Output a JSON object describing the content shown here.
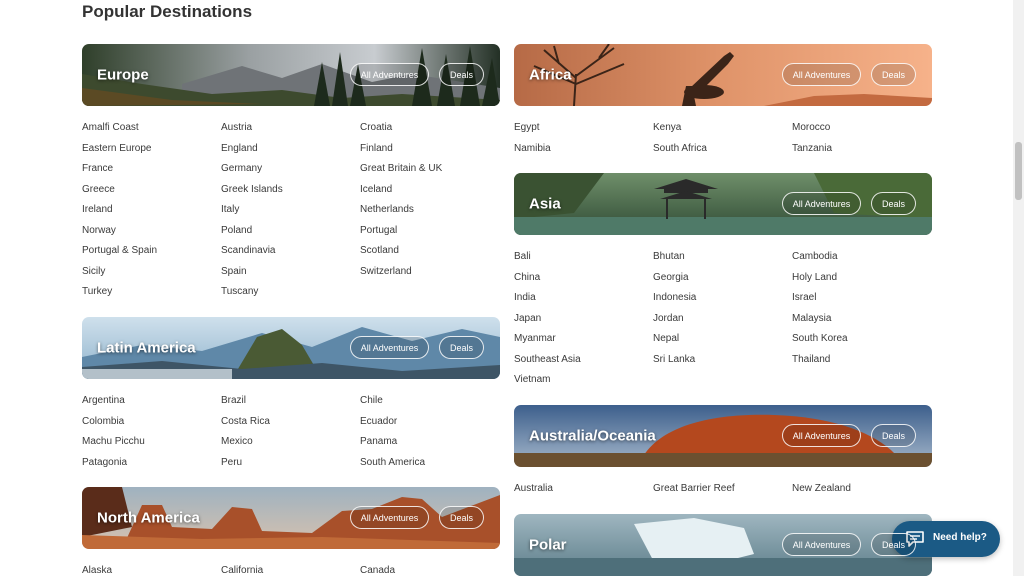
{
  "page_title": "Popular Destinations",
  "sections": {
    "europe": {
      "title": "Europe",
      "all_label": "All Adventures",
      "deals_label": "Deals",
      "links": [
        "Amalfi Coast",
        "Austria",
        "Croatia",
        "Eastern Europe",
        "England",
        "Finland",
        "France",
        "Germany",
        "Great Britain & UK",
        "Greece",
        "Greek Islands",
        "Iceland",
        "Ireland",
        "Italy",
        "Netherlands",
        "Norway",
        "Poland",
        "Portugal",
        "Portugal & Spain",
        "Scandinavia",
        "Scotland",
        "Sicily",
        "Spain",
        "Switzerland",
        "Turkey",
        "Tuscany"
      ]
    },
    "latin_america": {
      "title": "Latin America",
      "all_label": "All Adventures",
      "deals_label": "Deals",
      "links": [
        "Argentina",
        "Brazil",
        "Chile",
        "Colombia",
        "Costa Rica",
        "Ecuador",
        "Machu Picchu",
        "Mexico",
        "Panama",
        "Patagonia",
        "Peru",
        "South America"
      ]
    },
    "north_america": {
      "title": "North America",
      "all_label": "All Adventures",
      "deals_label": "Deals",
      "links": [
        "Alaska",
        "California",
        "Canada"
      ]
    },
    "africa": {
      "title": "Africa",
      "all_label": "All Adventures",
      "deals_label": "Deals",
      "links": [
        "Egypt",
        "Kenya",
        "Morocco",
        "Namibia",
        "South Africa",
        "Tanzania"
      ]
    },
    "asia": {
      "title": "Asia",
      "all_label": "All Adventures",
      "deals_label": "Deals",
      "links": [
        "Bali",
        "Bhutan",
        "Cambodia",
        "China",
        "Georgia",
        "Holy Land",
        "India",
        "Indonesia",
        "Israel",
        "Japan",
        "Jordan",
        "Malaysia",
        "Myanmar",
        "Nepal",
        "South Korea",
        "Southeast Asia",
        "Sri Lanka",
        "Thailand",
        "Vietnam"
      ]
    },
    "australia": {
      "title": "Australia/Oceania",
      "all_label": "All Adventures",
      "deals_label": "Deals",
      "links": [
        "Australia",
        "Great Barrier Reef",
        "New Zealand"
      ]
    },
    "polar": {
      "title": "Polar",
      "all_label": "All Adventures",
      "deals_label": "Deals",
      "links": []
    }
  },
  "help": {
    "label": "Need help?",
    "icon": "chat-icon"
  },
  "colors": {
    "help_button": "#1b5a85",
    "link_text": "#3a3a3a"
  }
}
